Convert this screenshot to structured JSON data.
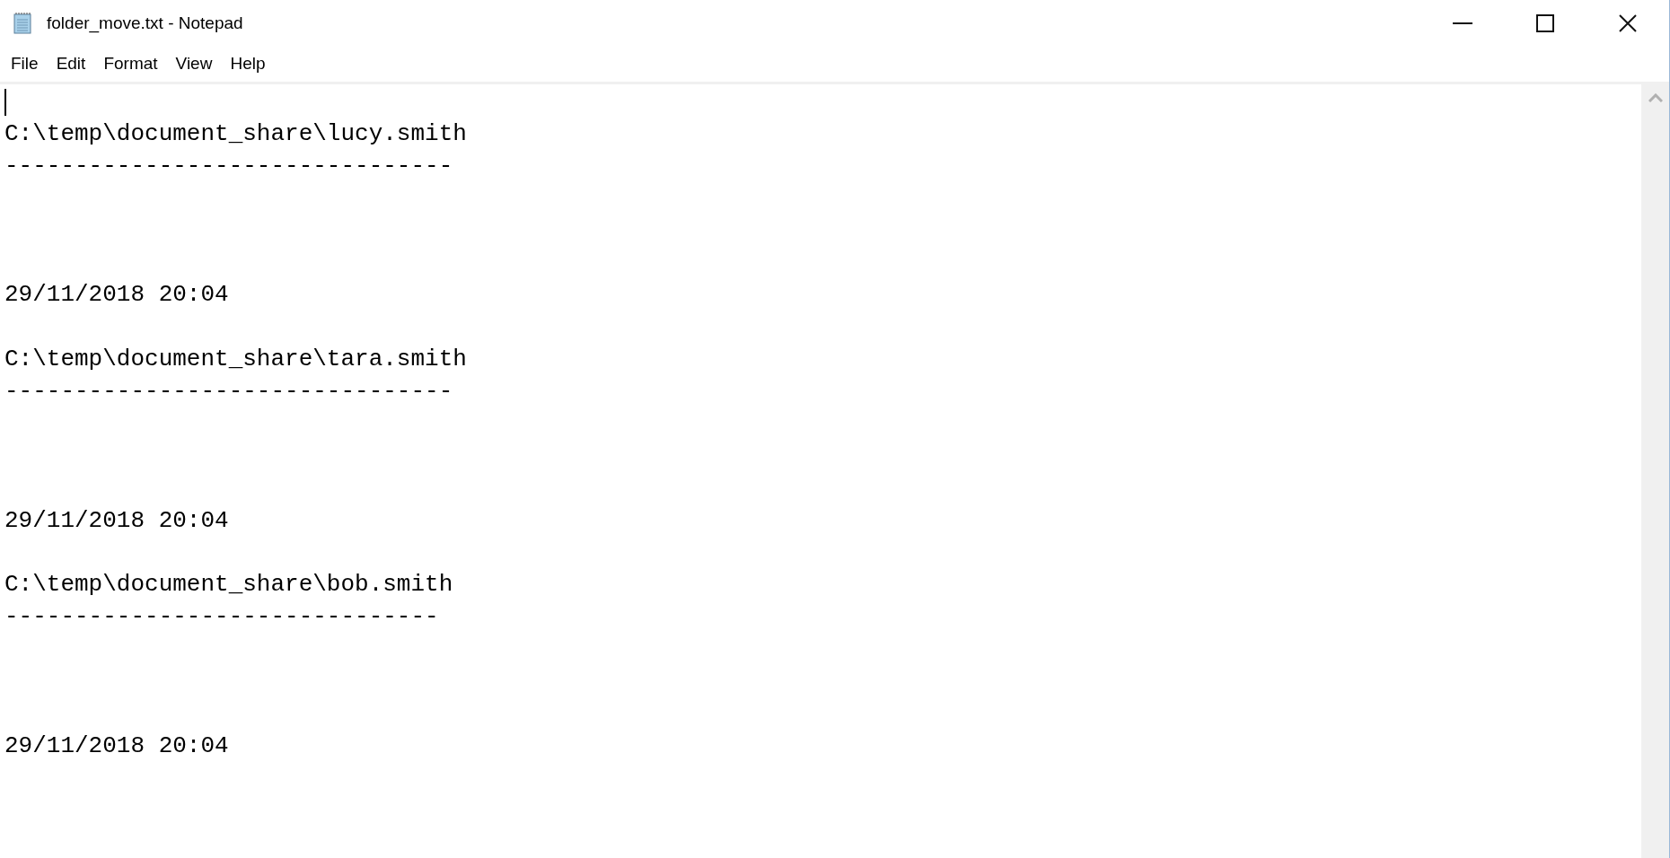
{
  "window": {
    "title": "folder_move.txt - Notepad"
  },
  "menu": [
    "File",
    "Edit",
    "Format",
    "View",
    "Help"
  ],
  "document": {
    "entries": [
      {
        "path": "C:\\temp\\document_share\\lucy.smith",
        "rule": "--------------------------------",
        "timestamp": "29/11/2018 20:04"
      },
      {
        "path": "C:\\temp\\document_share\\tara.smith",
        "rule": "--------------------------------",
        "timestamp": "29/11/2018 20:04"
      },
      {
        "path": "C:\\temp\\document_share\\bob.smith",
        "rule": "-------------------------------",
        "timestamp": "29/11/2018 20:04"
      }
    ]
  }
}
